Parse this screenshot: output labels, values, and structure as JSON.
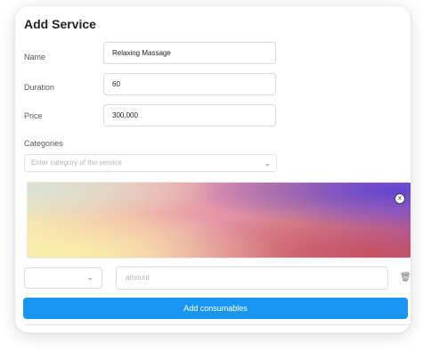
{
  "form": {
    "title": "Add Service",
    "name_label": "Name",
    "name_value": "Relaxing Massage",
    "duration_label": "Duration",
    "duration_value": "60",
    "price_label": "Price",
    "price_value": "300,000",
    "categories_label": "Categories",
    "categories_placeholder": "Enter category of the service",
    "amount_placeholder": "amount",
    "add_consumables_label": "Add consumables"
  },
  "icons": {
    "category_dropdown": "chevron-down-icon",
    "consumable_dropdown": "chevron-down-icon",
    "remove_image": "close-circle-icon",
    "remove_consumable": "trash-icon"
  },
  "colors": {
    "primary_button": "#1797f2"
  }
}
